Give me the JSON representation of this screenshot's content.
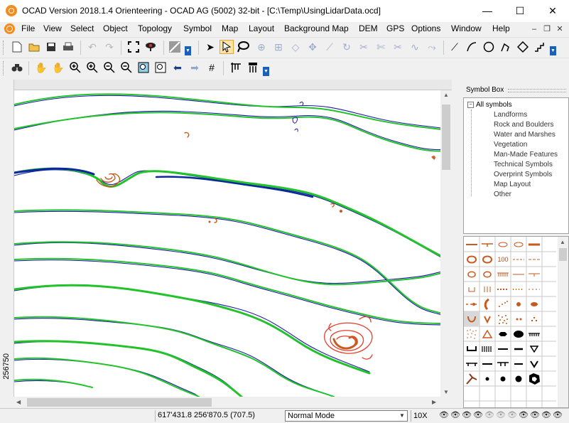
{
  "window": {
    "title": "OCAD Version 2018.1.4  Orienteering - OCAD AG (5002) 32-bit - [C:\\Temp\\UsingLidarData.ocd]",
    "minimize": "—",
    "maximize": "☐",
    "close": "✕"
  },
  "menu": {
    "items": [
      "File",
      "View",
      "Select",
      "Object",
      "Topology",
      "Symbol",
      "Map",
      "Layout",
      "Background Map",
      "DEM",
      "GPS",
      "Options",
      "Window",
      "Help"
    ],
    "mdi_minimize": "–",
    "mdi_restore": "❐",
    "mdi_close": "✕"
  },
  "ruler": {
    "left_label": "256750"
  },
  "symbol_box": {
    "title": "Symbol Box",
    "tree_root": "All symbols",
    "tree_root_toggle": "−",
    "categories": [
      "Landforms",
      "Rock and Boulders",
      "Water and Marshes",
      "Vegetation",
      "Man-Made Features",
      "Technical Symbols",
      "Overprint Symbols",
      "Map Layout",
      "Other"
    ],
    "symbol_text": "100"
  },
  "statusbar": {
    "coords": "617'431.8  256'870.5  (707.5)",
    "mode": "Normal Mode",
    "zoom": "10X"
  },
  "colors": {
    "contour_green": "#22c32a",
    "contour_blue": "#1a1aa8",
    "dark_blue": "#0a2a9a",
    "brown": "#c85a1e",
    "red": "#e0402a",
    "accent_orange": "#f28c1c"
  },
  "icons": {
    "toolbar1": [
      "new-icon",
      "open-icon",
      "save-icon",
      "print-icon",
      "undo-icon",
      "redo-icon",
      "fullscreen-icon",
      "preview-icon",
      "hatch-icon",
      "select-arrow-icon",
      "edit-object-icon",
      "lasso-icon",
      "move-icon",
      "node-icon",
      "rotate-icon",
      "scissors-icon",
      "curve-icon",
      "circle-icon",
      "rectangle-icon"
    ],
    "toolbar2": [
      "binoculars-icon",
      "hand-icon",
      "zoom-in-icon",
      "zoom-out-icon",
      "zoom-extent-icon",
      "back-icon",
      "forward-icon",
      "grid-icon"
    ]
  }
}
